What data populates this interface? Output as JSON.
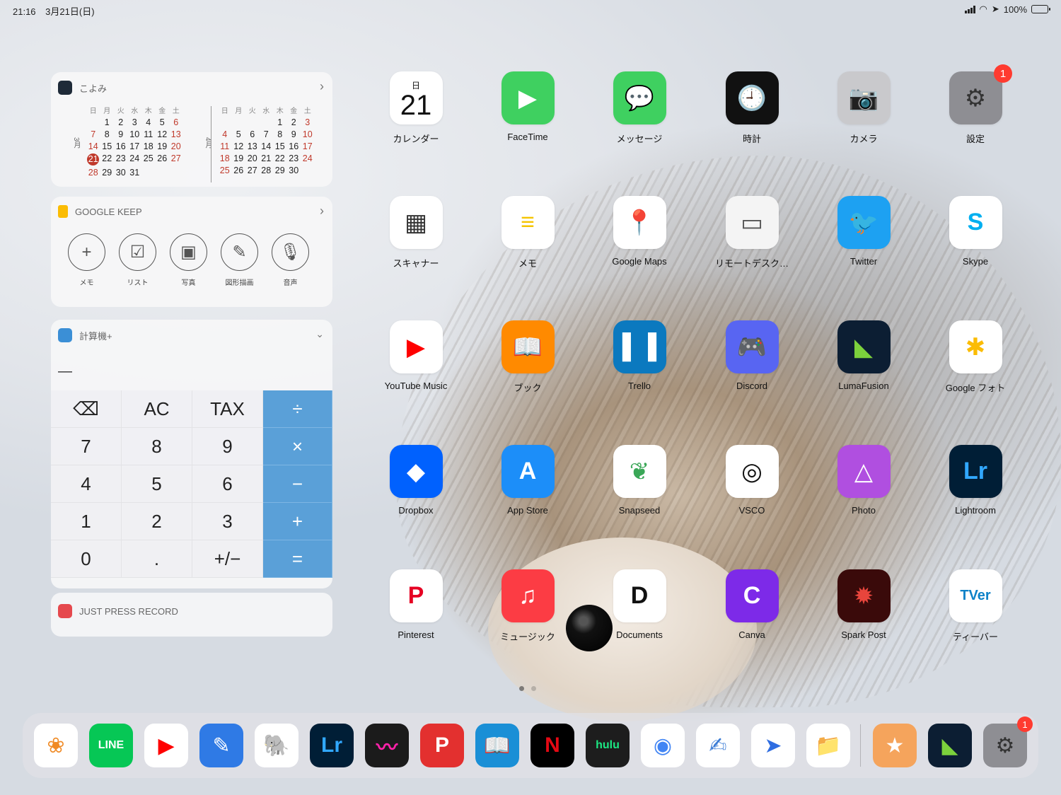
{
  "status": {
    "time": "21:16",
    "date": "3月21日(日)",
    "battery": "100%"
  },
  "widgets": {
    "calendar": {
      "title": "こよみ",
      "weekdays": [
        "日",
        "月",
        "火",
        "水",
        "木",
        "金",
        "土"
      ],
      "months": [
        {
          "label": "3月",
          "days": [
            "",
            "1",
            "2",
            "3",
            "4",
            "5",
            "6",
            "7",
            "8",
            "9",
            "10",
            "11",
            "12",
            "13",
            "14",
            "15",
            "16",
            "17",
            "18",
            "19",
            "20",
            "21",
            "22",
            "23",
            "24",
            "25",
            "26",
            "27",
            "28",
            "29",
            "30",
            "31"
          ]
        },
        {
          "label": "4月",
          "days": [
            "",
            "",
            "",
            "",
            "1",
            "2",
            "3",
            "4",
            "5",
            "6",
            "7",
            "8",
            "9",
            "10",
            "11",
            "12",
            "13",
            "14",
            "15",
            "16",
            "17",
            "18",
            "19",
            "20",
            "21",
            "22",
            "23",
            "24",
            "25",
            "26",
            "27",
            "28",
            "29",
            "30"
          ]
        }
      ],
      "today": "21"
    },
    "keep": {
      "title": "GOOGLE KEEP",
      "buttons": [
        {
          "label": "メモ",
          "icon": "plus-icon",
          "glyph": "+"
        },
        {
          "label": "リスト",
          "icon": "checkbox-icon",
          "glyph": "☑"
        },
        {
          "label": "写真",
          "icon": "image-icon",
          "glyph": "▣"
        },
        {
          "label": "図形描画",
          "icon": "brush-icon",
          "glyph": "✎"
        },
        {
          "label": "音声",
          "icon": "microphone-icon",
          "glyph": "🎙"
        }
      ]
    },
    "calculator": {
      "title": "計算機+",
      "display": "—",
      "keys": [
        {
          "label": "⌫",
          "op": false
        },
        {
          "label": "AC",
          "op": false
        },
        {
          "label": "TAX",
          "op": false
        },
        {
          "label": "÷",
          "op": true
        },
        {
          "label": "7",
          "op": false
        },
        {
          "label": "8",
          "op": false
        },
        {
          "label": "9",
          "op": false
        },
        {
          "label": "×",
          "op": true
        },
        {
          "label": "4",
          "op": false
        },
        {
          "label": "5",
          "op": false
        },
        {
          "label": "6",
          "op": false
        },
        {
          "label": "−",
          "op": true
        },
        {
          "label": "1",
          "op": false
        },
        {
          "label": "2",
          "op": false
        },
        {
          "label": "3",
          "op": false
        },
        {
          "label": "+",
          "op": true
        },
        {
          "label": "0",
          "op": false
        },
        {
          "label": ".",
          "op": false
        },
        {
          "label": "+/−",
          "op": false
        },
        {
          "label": "=",
          "op": true
        }
      ]
    },
    "jpr": {
      "title": "JUST PRESS RECORD"
    }
  },
  "apps": [
    {
      "label": "カレンダー",
      "icon": "calendar-icon",
      "bg": "#ffffff",
      "fg": "#111",
      "glyph": "21",
      "sub": "日"
    },
    {
      "label": "FaceTime",
      "icon": "video-camera-icon",
      "bg": "#3fd060",
      "fg": "#fff",
      "glyph": "▶"
    },
    {
      "label": "メッセージ",
      "icon": "speech-bubble-icon",
      "bg": "#3fd060",
      "fg": "#fff",
      "glyph": "💬"
    },
    {
      "label": "時計",
      "icon": "clock-icon",
      "bg": "#111111",
      "fg": "#fff",
      "glyph": "🕘"
    },
    {
      "label": "カメラ",
      "icon": "camera-icon",
      "bg": "#c9c9cc",
      "fg": "#222",
      "glyph": "📷"
    },
    {
      "label": "設定",
      "icon": "gear-icon",
      "bg": "#8e8e93",
      "fg": "#333",
      "glyph": "⚙",
      "badge": "1"
    },
    {
      "label": "スキャナー",
      "icon": "scanner-icon",
      "bg": "#ffffff",
      "fg": "#333",
      "glyph": "▦"
    },
    {
      "label": "メモ",
      "icon": "notes-icon",
      "bg": "#ffffff",
      "fg": "#f5c400",
      "glyph": "≡"
    },
    {
      "label": "Google Maps",
      "icon": "map-pin-icon",
      "bg": "#ffffff",
      "fg": "#ea4335",
      "glyph": "📍"
    },
    {
      "label": "リモートデスク…",
      "icon": "remote-desktop-icon",
      "bg": "#f4f4f4",
      "fg": "#555",
      "glyph": "▭"
    },
    {
      "label": "Twitter",
      "icon": "bird-icon",
      "bg": "#1da1f2",
      "fg": "#fff",
      "glyph": "🐦"
    },
    {
      "label": "Skype",
      "icon": "skype-icon",
      "bg": "#ffffff",
      "fg": "#00aff0",
      "glyph": "S"
    },
    {
      "label": "YouTube Music",
      "icon": "play-circle-icon",
      "bg": "#ffffff",
      "fg": "#ff0000",
      "glyph": "▶"
    },
    {
      "label": "ブック",
      "icon": "book-icon",
      "bg": "#ff8a00",
      "fg": "#fff",
      "glyph": "📖"
    },
    {
      "label": "Trello",
      "icon": "board-icon",
      "bg": "#0b79bf",
      "fg": "#fff",
      "glyph": "▌▐"
    },
    {
      "label": "Discord",
      "icon": "controller-icon",
      "bg": "#5865f2",
      "fg": "#fff",
      "glyph": "🎮"
    },
    {
      "label": "LumaFusion",
      "icon": "film-icon",
      "bg": "#0c1e33",
      "fg": "#7cd13c",
      "glyph": "◣"
    },
    {
      "label": "Google フォト",
      "icon": "pinwheel-icon",
      "bg": "#ffffff",
      "fg": "#fbbc04",
      "glyph": "✱"
    },
    {
      "label": "Dropbox",
      "icon": "box-icon",
      "bg": "#0061fe",
      "fg": "#fff",
      "glyph": "◆"
    },
    {
      "label": "App Store",
      "icon": "app-store-icon",
      "bg": "#1c8ef9",
      "fg": "#fff",
      "glyph": "A"
    },
    {
      "label": "Snapseed",
      "icon": "leaf-icon",
      "bg": "#ffffff",
      "fg": "#3aa757",
      "glyph": "❦"
    },
    {
      "label": "VSCO",
      "icon": "aperture-icon",
      "bg": "#ffffff",
      "fg": "#111",
      "glyph": "◎"
    },
    {
      "label": "Photo",
      "icon": "affinity-icon",
      "bg": "#b04fe0",
      "fg": "#fff",
      "glyph": "△"
    },
    {
      "label": "Lightroom",
      "icon": "lightroom-icon",
      "bg": "#001e36",
      "fg": "#31a8ff",
      "glyph": "Lr"
    },
    {
      "label": "Pinterest",
      "icon": "pinterest-icon",
      "bg": "#ffffff",
      "fg": "#e60023",
      "glyph": "P"
    },
    {
      "label": "ミュージック",
      "icon": "music-note-icon",
      "bg": "#fc3c44",
      "fg": "#fff",
      "glyph": "♫"
    },
    {
      "label": "Documents",
      "icon": "documents-icon",
      "bg": "#ffffff",
      "fg": "#111",
      "glyph": "D"
    },
    {
      "label": "Canva",
      "icon": "canva-icon",
      "bg": "#7d2ae8",
      "fg": "#fff",
      "glyph": "C"
    },
    {
      "label": "Spark Post",
      "icon": "spark-icon",
      "bg": "#3a0a0a",
      "fg": "#e8453c",
      "glyph": "✹"
    },
    {
      "label": "ティーバー",
      "icon": "tver-icon",
      "bg": "#ffffff",
      "fg": "#0d82c8",
      "glyph": "TVer"
    }
  ],
  "dock": [
    {
      "name": "photos",
      "icon": "photos-icon",
      "bg": "#ffffff",
      "fg": "#f08a24",
      "glyph": "❀"
    },
    {
      "name": "line",
      "icon": "line-icon",
      "bg": "#06c755",
      "fg": "#fff",
      "glyph": "LINE"
    },
    {
      "name": "youtube",
      "icon": "youtube-icon",
      "bg": "#ffffff",
      "fg": "#ff0000",
      "glyph": "▶"
    },
    {
      "name": "pen",
      "icon": "pen-icon",
      "bg": "#2f7ae5",
      "fg": "#fff",
      "glyph": "✎"
    },
    {
      "name": "evernote",
      "icon": "elephant-icon",
      "bg": "#ffffff",
      "fg": "#00a82d",
      "glyph": "🐘"
    },
    {
      "name": "lightroom",
      "icon": "lightroom-icon",
      "bg": "#001e36",
      "fg": "#31a8ff",
      "glyph": "Lr"
    },
    {
      "name": "procreate",
      "icon": "brush-stroke-icon",
      "bg": "#1b1b1b",
      "fg": "#f2a",
      "glyph": "〰"
    },
    {
      "name": "pdf",
      "icon": "pdf-icon",
      "bg": "#e3302f",
      "fg": "#fff",
      "glyph": "P"
    },
    {
      "name": "kindle",
      "icon": "reader-icon",
      "bg": "#1a8fd6",
      "fg": "#111",
      "glyph": "📖"
    },
    {
      "name": "netflix",
      "icon": "netflix-icon",
      "bg": "#000000",
      "fg": "#e50914",
      "glyph": "N"
    },
    {
      "name": "hulu",
      "icon": "hulu-icon",
      "bg": "#1d1d1d",
      "fg": "#1ce783",
      "glyph": "hulu"
    },
    {
      "name": "chrome",
      "icon": "chrome-icon",
      "bg": "#ffffff",
      "fg": "#4285f4",
      "glyph": "◉"
    },
    {
      "name": "goodnotes",
      "icon": "notebook-icon",
      "bg": "#ffffff",
      "fg": "#3a7bd5",
      "glyph": "✍"
    },
    {
      "name": "spark",
      "icon": "paper-plane-icon",
      "bg": "#ffffff",
      "fg": "#2f6de1",
      "glyph": "➤"
    },
    {
      "name": "files",
      "icon": "folder-icon",
      "bg": "#ffffff",
      "fg": "#1d8cf8",
      "glyph": "📁"
    },
    {
      "name": "game",
      "icon": "game-icon",
      "bg": "#f5a45c",
      "fg": "#fff",
      "glyph": "★"
    },
    {
      "name": "lumafusion",
      "icon": "film-icon",
      "bg": "#0c1e33",
      "fg": "#7cd13c",
      "glyph": "◣"
    },
    {
      "name": "settings",
      "icon": "gear-icon",
      "bg": "#8e8e93",
      "fg": "#333",
      "glyph": "⚙",
      "badge": "1"
    }
  ]
}
